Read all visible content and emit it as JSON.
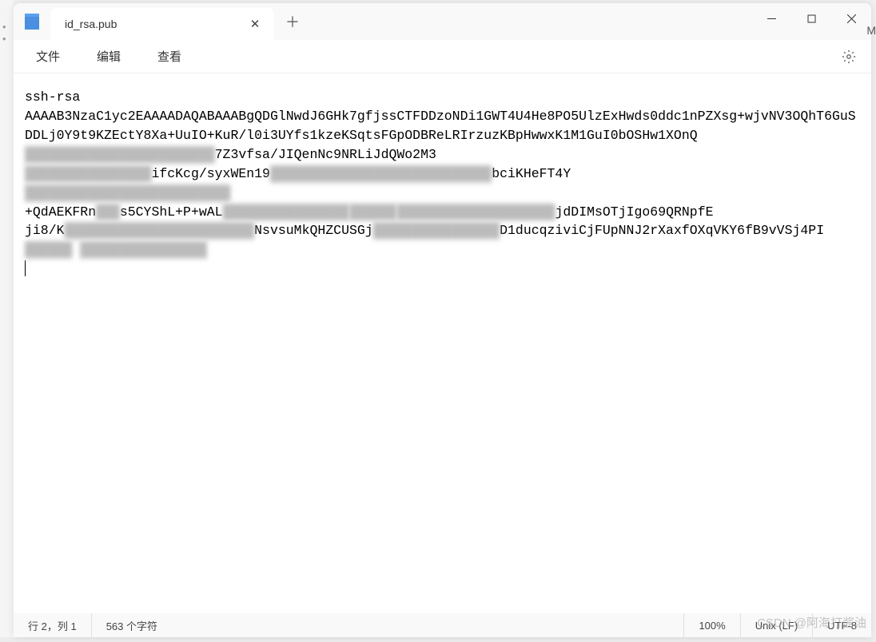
{
  "tab": {
    "title": "id_rsa.pub"
  },
  "menu": {
    "file": "文件",
    "edit": "编辑",
    "view": "查看"
  },
  "content": {
    "line1": "ssh-rsa",
    "line2": "AAAAB3NzaC1yc2EAAAADAQABAAABgQDGlNwdJ6GHk7gfjssCTFDDzoNDi1GWT4U4He8PO5UlzExHwds0ddc1nPZXsg+wjvNV3OQhT6GuSDDLj0Y9t9KZEctY8Xa+UuIO+KuR/l0i3UYfs1kzeKSqtsFGpODBReLRIrzuzKBpHwwxK1M1GuI0bOSHw1XOnQ",
    "line3_a": "7Z3vfsa/JIQenNc9NRLiJdQWo2M3",
    "line3_b": "ifcKcg/syxWEn19",
    "line3_c": "bciKHeFT4Y",
    "line5_a": "+QdAEKFRn",
    "line5_b": "s5CYShL+P+wAL",
    "line5_c": "jdDIMsOTjIgo69QRNpfE",
    "line6_a": "ji8/K",
    "line6_b": "NsvsuMkQHZCUSGj",
    "line6_c": "D1ducqziviCjFUpNNJ2rXaxfOXqVKY6fB9vVSj4PI",
    "blur1": "████████████████████████",
    "blur2": "███",
    "blur3": "████████████████",
    "blur4": "████████████████████████████",
    "blur5": "██████████████████████████",
    "blur6": "███",
    "blur7": "████████████████",
    "blur8": "██████",
    "blur9": "████████████████████",
    "blur10": "████████████████████████",
    "blur11": "████████████████",
    "blur12": "██████",
    "blur13": "████████████████"
  },
  "statusbar": {
    "position": "行 2，列 1",
    "chars": "563 个字符",
    "zoom": "100%",
    "eol": "Unix (LF)",
    "encoding": "UTF-8"
  },
  "watermark": "CSDN @阿海打酱油",
  "edge_label": "M"
}
